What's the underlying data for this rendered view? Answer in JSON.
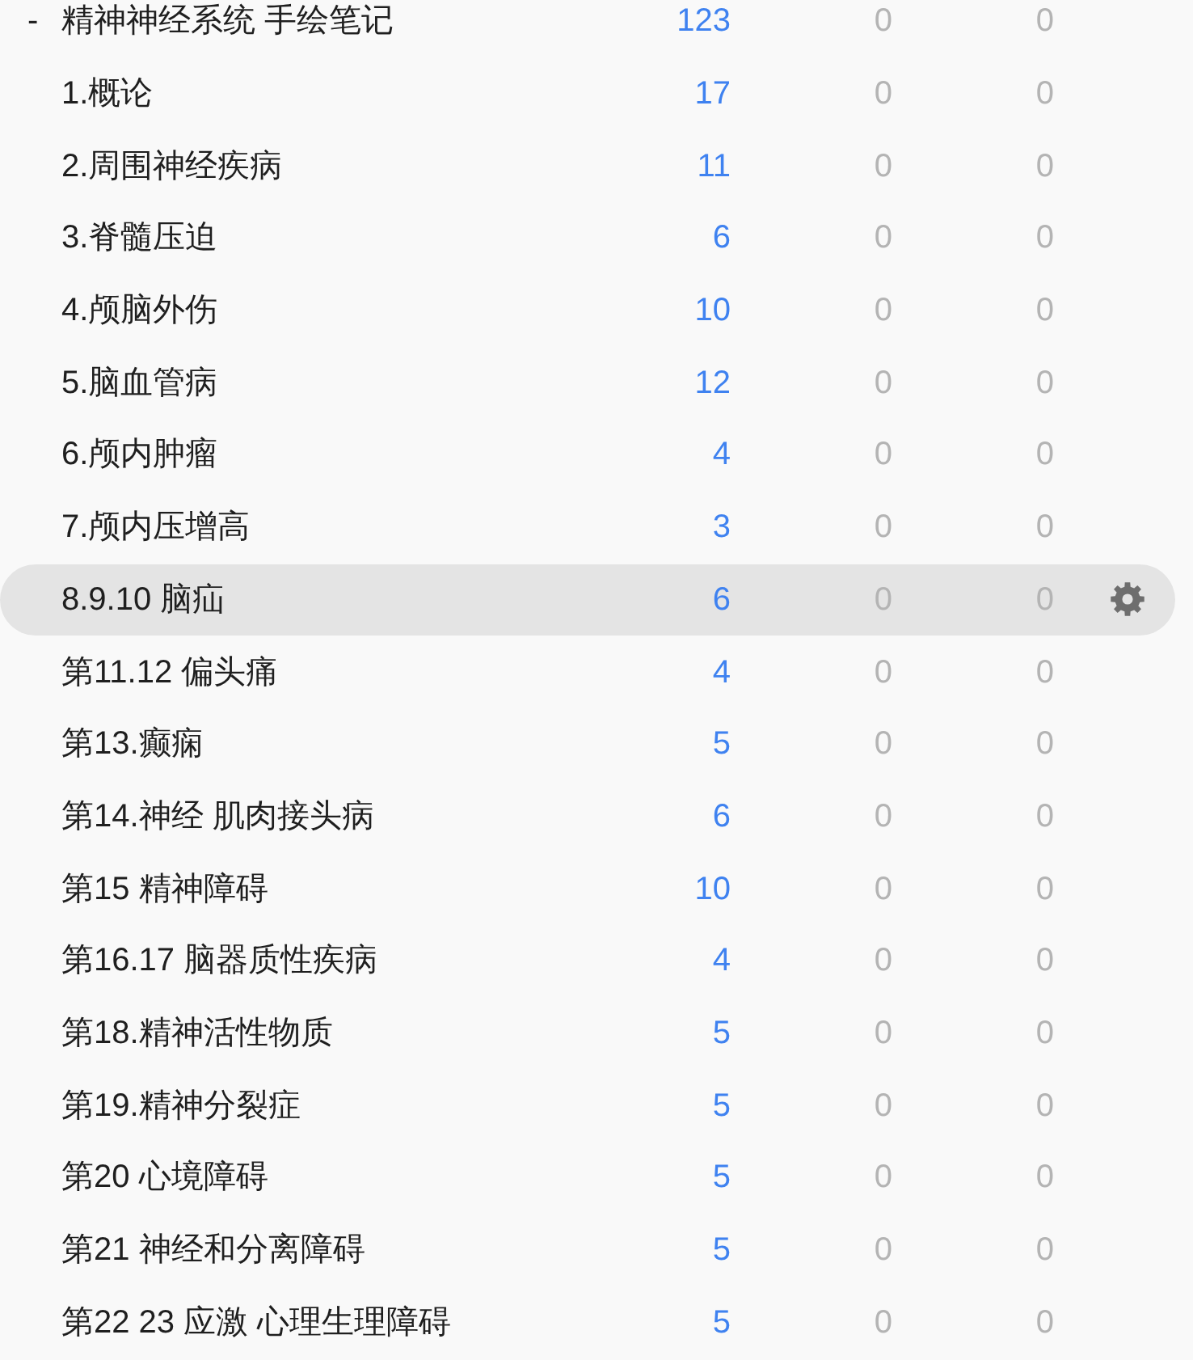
{
  "decks": [
    {
      "toggle": "-",
      "name": "精神神经系统 手绘笔记",
      "counts": [
        "123",
        "0",
        "0"
      ],
      "selected": false,
      "children": [
        {
          "name": "1.概论",
          "counts": [
            "17",
            "0",
            "0"
          ],
          "selected": false
        },
        {
          "name": "2.周围神经疾病",
          "counts": [
            "11",
            "0",
            "0"
          ],
          "selected": false
        },
        {
          "name": "3.脊髓压迫",
          "counts": [
            "6",
            "0",
            "0"
          ],
          "selected": false
        },
        {
          "name": "4.颅脑外伤",
          "counts": [
            "10",
            "0",
            "0"
          ],
          "selected": false
        },
        {
          "name": "5.脑血管病",
          "counts": [
            "12",
            "0",
            "0"
          ],
          "selected": false
        },
        {
          "name": "6.颅内肿瘤",
          "counts": [
            "4",
            "0",
            "0"
          ],
          "selected": false
        },
        {
          "name": "7.颅内压增高",
          "counts": [
            "3",
            "0",
            "0"
          ],
          "selected": false
        },
        {
          "name": "8.9.10 脑疝",
          "counts": [
            "6",
            "0",
            "0"
          ],
          "selected": true
        },
        {
          "name": "第11.12 偏头痛",
          "counts": [
            "4",
            "0",
            "0"
          ],
          "selected": false
        },
        {
          "name": "第13.癫痫",
          "counts": [
            "5",
            "0",
            "0"
          ],
          "selected": false
        },
        {
          "name": "第14.神经 肌肉接头病",
          "counts": [
            "6",
            "0",
            "0"
          ],
          "selected": false
        },
        {
          "name": "第15 精神障碍",
          "counts": [
            "10",
            "0",
            "0"
          ],
          "selected": false
        },
        {
          "name": "第16.17 脑器质性疾病",
          "counts": [
            "4",
            "0",
            "0"
          ],
          "selected": false
        },
        {
          "name": "第18.精神活性物质",
          "counts": [
            "5",
            "0",
            "0"
          ],
          "selected": false
        },
        {
          "name": "第19.精神分裂症",
          "counts": [
            "5",
            "0",
            "0"
          ],
          "selected": false
        },
        {
          "name": "第20 心境障碍",
          "counts": [
            "5",
            "0",
            "0"
          ],
          "selected": false
        },
        {
          "name": "第21 神经和分离障碍",
          "counts": [
            "5",
            "0",
            "0"
          ],
          "selected": false
        },
        {
          "name": "第22 23 应激 心理生理障碍",
          "counts": [
            "5",
            "0",
            "0"
          ],
          "selected": false
        }
      ]
    }
  ]
}
